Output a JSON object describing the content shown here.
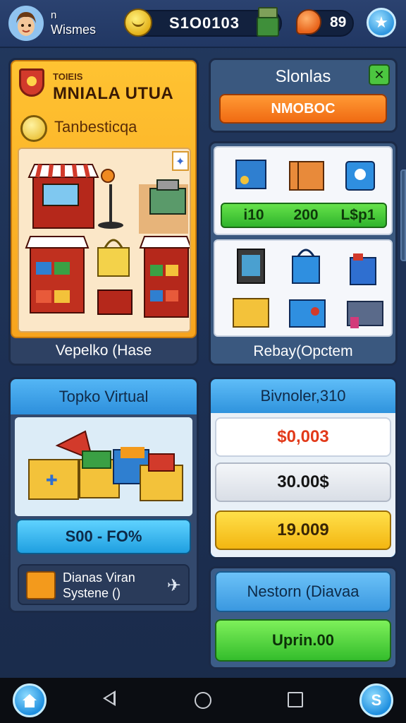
{
  "header": {
    "player_initial": "n",
    "player_name": "Wismes",
    "coins": "S1O0103",
    "gems": "89"
  },
  "shop_panel": {
    "small_title": "TOIEIS",
    "big_title": "MNIALA UTUA",
    "subtitle": "Tanbesticqa",
    "footer": "Vepelko (Hase"
  },
  "slots_panel": {
    "title": "Slonlas",
    "close": "✕",
    "button": "NMOBOC"
  },
  "items_panel": {
    "prices": [
      "i10",
      "200",
      "L$p1"
    ],
    "footer": "Rebay(Opctem"
  },
  "virtual_panel": {
    "title": "Topko Virtual",
    "button": "S00 - FO%",
    "system_line1": "Dianas Viran",
    "system_line2": "Systene ()"
  },
  "values_panel": {
    "title": "Bivnoler,310",
    "value_red": "$0,003",
    "value_white": "30.00$",
    "value_gold": "19.009"
  },
  "actions_panel": {
    "secondary": "Nestorn (Diavaa",
    "primary": "Uprin.00"
  },
  "nav": {
    "social": "S"
  }
}
